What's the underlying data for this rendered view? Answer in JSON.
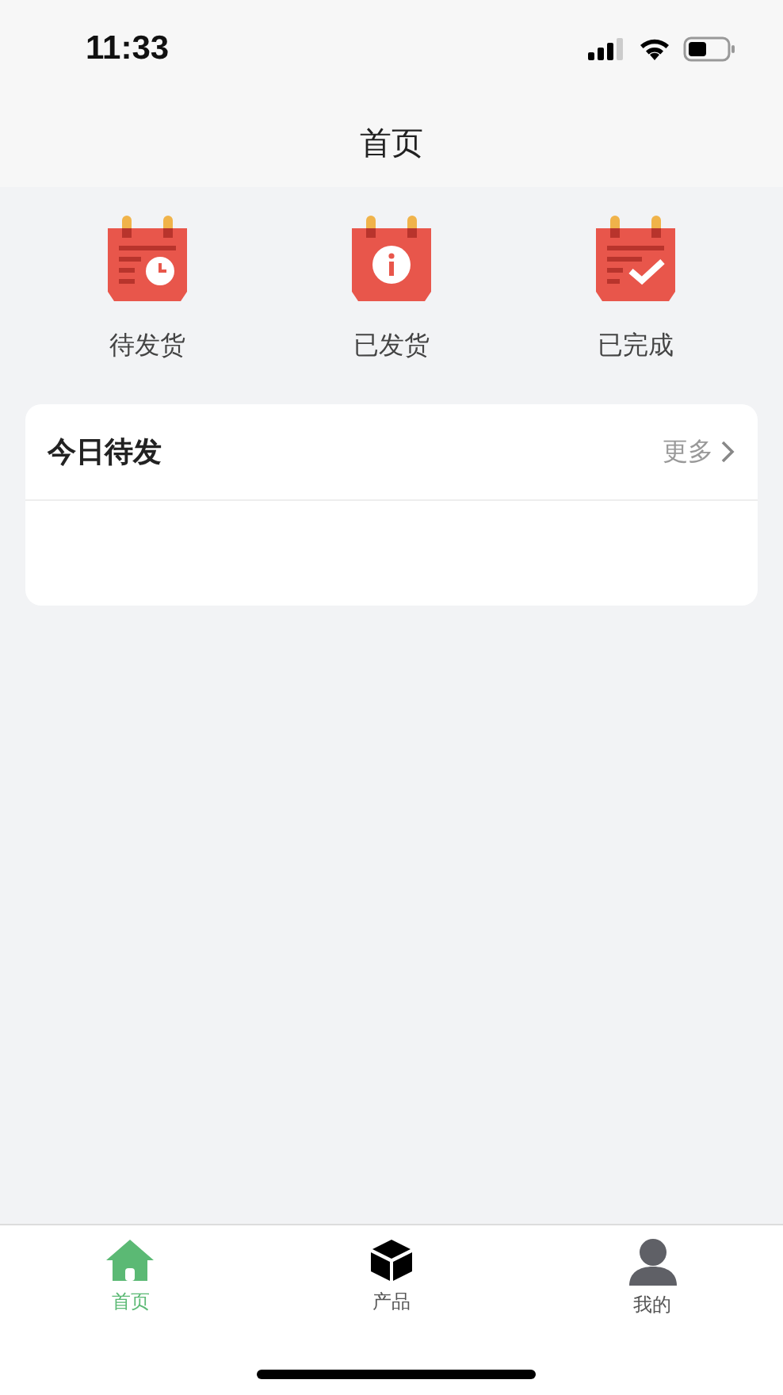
{
  "status_bar": {
    "time": "11:33"
  },
  "nav_bar": {
    "title": "首页"
  },
  "shortcuts": [
    {
      "kind": "pending",
      "label": "待发货"
    },
    {
      "kind": "shipped",
      "label": "已发货"
    },
    {
      "kind": "done",
      "label": "已完成"
    }
  ],
  "today_card": {
    "title": "今日待发",
    "more": "更多"
  },
  "tab_bar": [
    {
      "kind": "home",
      "label": "首页",
      "selected": true
    },
    {
      "kind": "product",
      "label": "产品",
      "selected": false
    },
    {
      "kind": "profile",
      "label": "我的",
      "selected": false
    }
  ]
}
